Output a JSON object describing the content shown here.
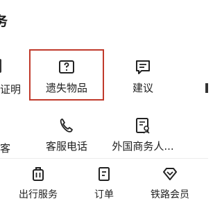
{
  "section": {
    "title": "务"
  },
  "grid": {
    "row1": {
      "left_partial_label": "证明",
      "lost_items_label": "遗失物品",
      "suggestion_label": "建议"
    },
    "row2": {
      "left_partial_label": "客",
      "customer_service_label": "客服电话",
      "foreign_business_label": "外国商务人..."
    }
  },
  "bottom_bar": {
    "items": [
      {
        "label": "出行服务",
        "icon": "luggage-icon"
      },
      {
        "label": "订单",
        "icon": "order-icon"
      },
      {
        "label": "铁路会员",
        "icon": "diamond-icon"
      }
    ]
  },
  "colors": {
    "highlight": "#c0392b",
    "text": "#1f1f1f"
  }
}
